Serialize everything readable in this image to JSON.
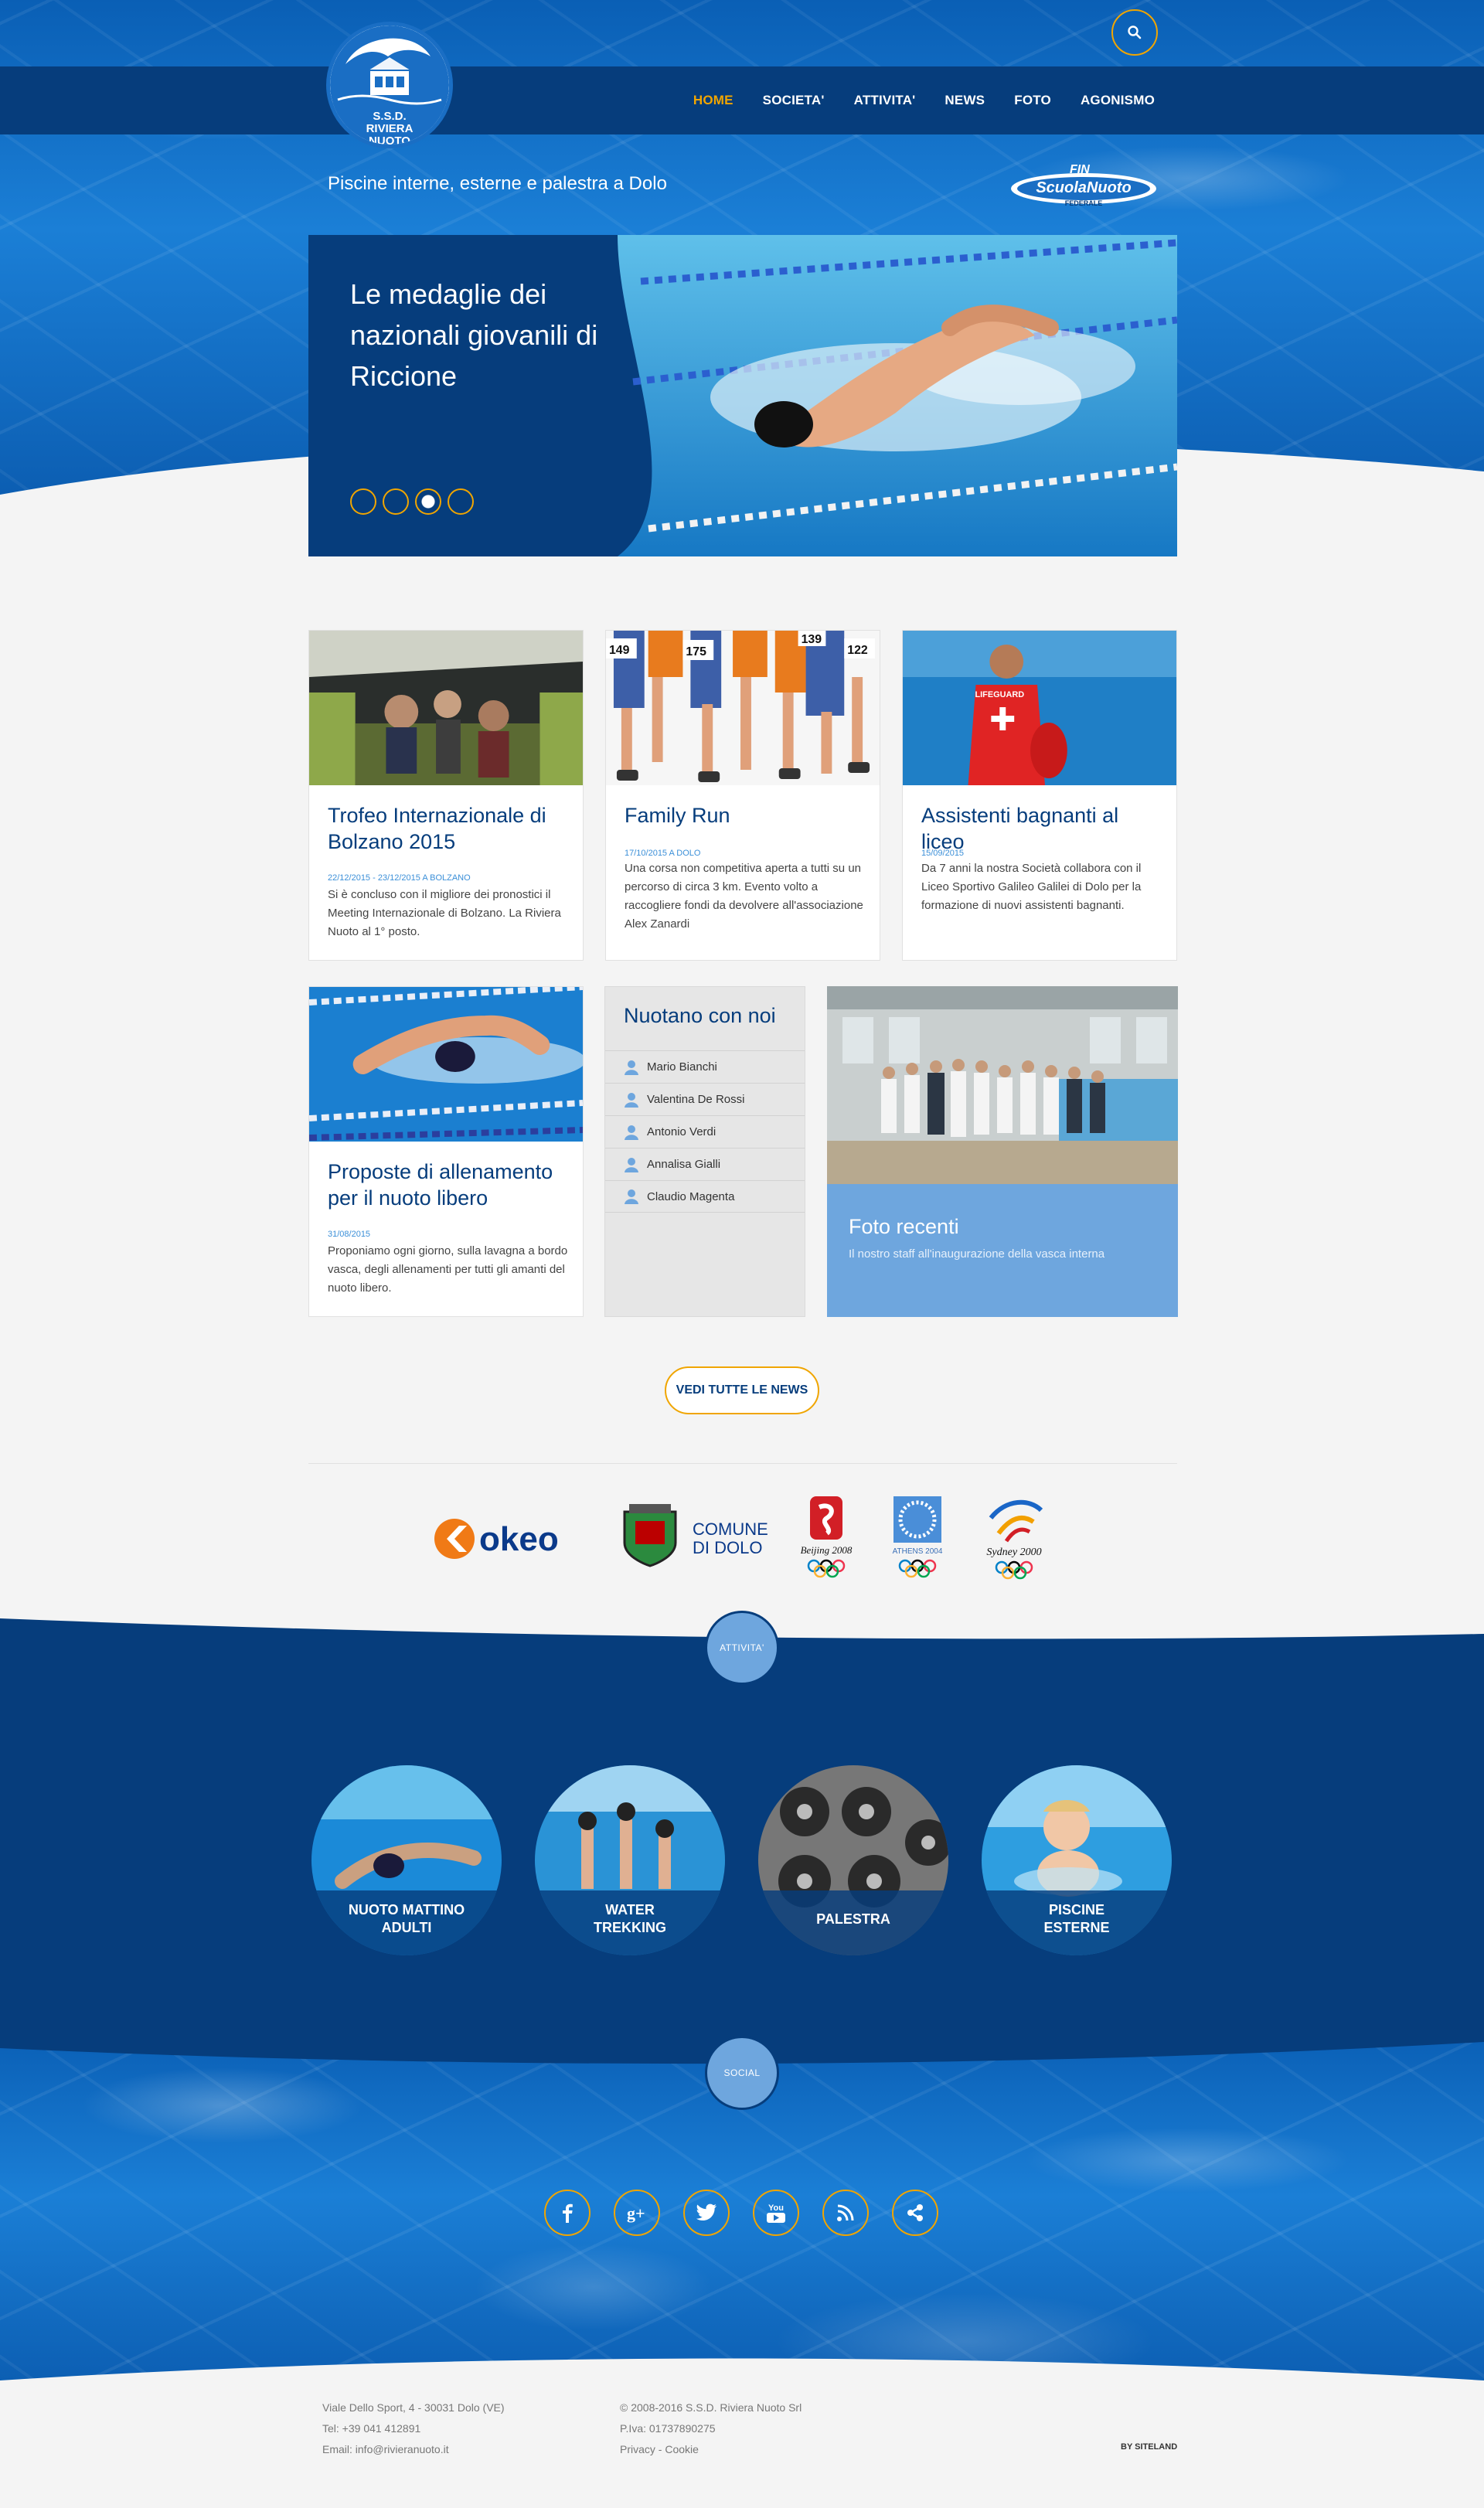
{
  "header": {
    "logo_text_line1": "S.S.D.",
    "logo_text_line2": "RIVIERA",
    "logo_text_line3": "NUOTO",
    "tagline": "Piscine interne, esterne e palestra a Dolo",
    "fin_logo_text": "ScuolaNuoto",
    "fin_logo_sub": "FEDERALE",
    "fin_mark": "FIN"
  },
  "nav": {
    "items": [
      "HOME",
      "SOCIETA'",
      "ATTIVITA'",
      "NEWS",
      "FOTO",
      "AGONISMO"
    ],
    "active": "HOME"
  },
  "slider": {
    "title": "Le medaglie dei nazionali giovanili di Riccione",
    "slides_count": 4,
    "active_slide": 3
  },
  "news": [
    {
      "title": "Trofeo Internazionale di Bolzano 2015",
      "date": "22/12/2015 - 23/12/2015 A BOLZANO",
      "text": "Si è concluso con il migliore dei pronostici il Meeting Internazionale di Bolzano. La Riviera Nuoto al 1° posto."
    },
    {
      "title": "Family Run",
      "date": "17/10/2015 A DOLO",
      "text": "Una corsa non competitiva aperta a tutti su un percorso di circa 3 km. Evento volto a raccogliere fondi da devolvere all'associazione Alex Zanardi"
    },
    {
      "title": "Assistenti bagnanti al liceo",
      "date": "15/09/2015",
      "text": "Da 7 anni la nostra Società collabora con il Liceo Sportivo Galileo Galilei di Dolo per la formazione di nuovi assistenti bagnanti."
    },
    {
      "title": "Proposte di allenamento per il nuoto libero",
      "date": "31/08/2015",
      "text": "Proponiamo ogni giorno, sulla lavagna a bordo vasca, degli allenamenti per tutti gli amanti del nuoto libero."
    }
  ],
  "runner_bibs": [
    "149",
    "175",
    "139",
    "122"
  ],
  "lifeguard_text": "LIFEGUARD",
  "swimmers": {
    "title": "Nuotano con noi",
    "names": [
      "Mario Bianchi",
      "Valentina De Rossi",
      "Antonio Verdi",
      "Annalisa Gialli",
      "Claudio Magenta"
    ]
  },
  "photos": {
    "title": "Foto recenti",
    "caption": "Il nostro staff all'inaugurazione della vasca interna"
  },
  "all_news_button": "VEDI TUTTE LE NEWS",
  "sponsors": {
    "okeo": "okeo",
    "comune_line1": "COMUNE",
    "comune_line2": "DI DOLO",
    "beijing": "Beijing 2008",
    "athens": "ATHENS 2004",
    "sydney": "Sydney 2000"
  },
  "activities": {
    "badge": "ATTIVITA'",
    "items": [
      {
        "line1": "NUOTO MATTINO",
        "line2": "ADULTI"
      },
      {
        "line1": "WATER",
        "line2": "TREKKING"
      },
      {
        "line1": "PALESTRA",
        "line2": ""
      },
      {
        "line1": "PISCINE",
        "line2": "ESTERNE"
      }
    ]
  },
  "social": {
    "badge": "SOCIAL",
    "icons": [
      "facebook-icon",
      "google-plus-icon",
      "twitter-icon",
      "youtube-icon",
      "rss-icon",
      "share-icon"
    ],
    "gplus_text": "g+",
    "youtube_text": "You"
  },
  "footer": {
    "address": "Viale Dello Sport, 4 - 30031 Dolo (VE)",
    "phone": "Tel: +39 041 412891",
    "email": "Email: info@rivieranuoto.it",
    "copyright": "© 2008-2016 S.S.D. Riviera Nuoto Srl",
    "piva": "P.Iva: 01737890275",
    "privacy": "Privacy",
    "privacy_sep": " - ",
    "cookie": "Cookie",
    "credit": "BY SITELAND"
  },
  "colors": {
    "navy": "#063d7c",
    "accent": "#f0a500",
    "light_blue": "#6ea6de",
    "pool_blue": "#1b7fd6"
  }
}
